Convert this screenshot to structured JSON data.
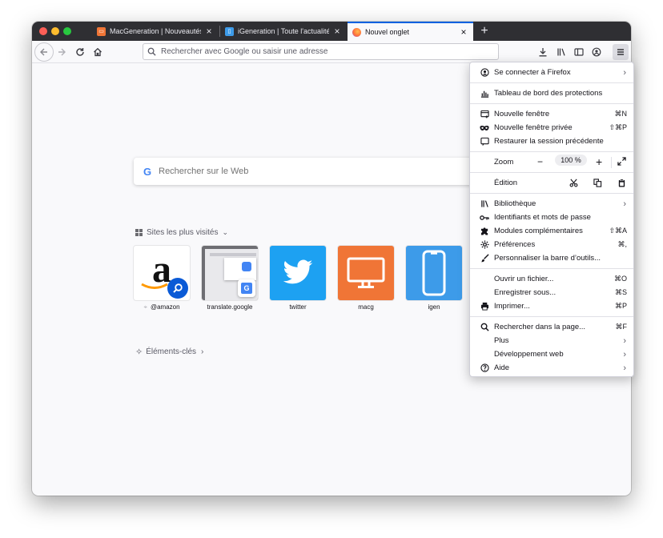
{
  "tabs": [
    {
      "label": "MacGeneration | Nouveautés, actualité",
      "favicon": "macg-icon",
      "color": "#f07536"
    },
    {
      "label": "iGeneration | Toute l'actualité iPhone",
      "favicon": "igen-icon",
      "color": "#3d9be9"
    },
    {
      "label": "Nouvel onglet",
      "favicon": "firefox-icon",
      "color": "#ff7139"
    }
  ],
  "toolbar": {
    "url_placeholder": "Rechercher avec Google ou saisir une adresse"
  },
  "newtab": {
    "search_placeholder": "Rechercher sur le Web",
    "topsites_title": "Sites les plus visités",
    "highlights_title": "Éléments-clés",
    "sites": [
      {
        "label": "@amazon",
        "icon": "amazon-logo-icon"
      },
      {
        "label": "translate.google",
        "icon": "google-translate-thumbnail"
      },
      {
        "label": "twitter",
        "icon": "twitter-bird-icon",
        "color": "#1da1f2"
      },
      {
        "label": "macg",
        "icon": "monitor-icon",
        "color": "#f07536"
      },
      {
        "label": "igen",
        "icon": "phone-icon",
        "color": "#3d9be9"
      }
    ]
  },
  "menu": {
    "signin": "Se connecter à Firefox",
    "protections": "Tableau de bord des protections",
    "new_window": {
      "label": "Nouvelle fenêtre",
      "shortcut": "⌘N"
    },
    "private_window": {
      "label": "Nouvelle fenêtre privée",
      "shortcut": "⇧⌘P"
    },
    "restore_session": "Restaurer la session précédente",
    "zoom": {
      "label": "Zoom",
      "value": "100 %"
    },
    "edit": "Édition",
    "library": "Bibliothèque",
    "logins": "Identifiants et mots de passe",
    "addons": {
      "label": "Modules complémentaires",
      "shortcut": "⇧⌘A"
    },
    "preferences": {
      "label": "Préférences",
      "shortcut": "⌘,"
    },
    "customize": "Personnaliser la barre d’outils...",
    "open_file": {
      "label": "Ouvrir un fichier...",
      "shortcut": "⌘O"
    },
    "save_as": {
      "label": "Enregistrer sous...",
      "shortcut": "⌘S"
    },
    "print": {
      "label": "Imprimer...",
      "shortcut": "⌘P"
    },
    "find": {
      "label": "Rechercher dans la page...",
      "shortcut": "⌘F"
    },
    "more": "Plus",
    "webdev": "Développement web",
    "help": "Aide"
  }
}
